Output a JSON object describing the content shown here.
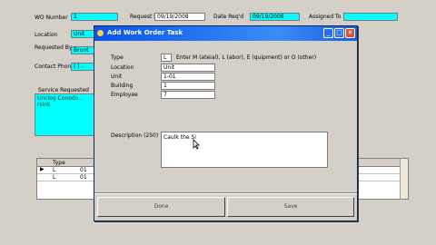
{
  "background_form": {
    "wo_number_label": "WO Number",
    "wo_number_value": "1",
    "request_date_label": "Request Date",
    "request_date_value": "09/19/2008",
    "date_reqd_label": "Date Req'd",
    "date_reqd_value": "09/19/2008",
    "assigned_to_label": "Assigned To",
    "assigned_to_value": "",
    "location_label": "Location",
    "location_value": "Unit",
    "requested_by_label": "Requested By",
    "requested_by_value": "Brunt",
    "contact_phone_label": "Contact Phone",
    "contact_phone_value": "( ) -",
    "service_requested_label": "Service Requested",
    "service_requested_value": "Unclog Conodo... rsink",
    "grid_headers": [
      "Type"
    ],
    "grid_rows": [
      {
        "marker": "▶",
        "type": "L",
        "value": "01"
      },
      {
        "marker": "",
        "type": "L",
        "value": "01"
      }
    ]
  },
  "dialog": {
    "title": "Add Work Order Task",
    "minimize_glyph": "_",
    "maximize_glyph": "□",
    "close_glyph": "✕",
    "type_label": "Type",
    "type_value": "L",
    "type_hint": "Enter M (ateial), L (abor), E (quipment) or O (other)",
    "location_label": "Location",
    "location_value": "Unit",
    "unit_label": "Unit",
    "unit_value": "1-01",
    "building_label": "Building",
    "building_value": "1",
    "employee_label": "Employee",
    "employee_value": "7",
    "description_label": "Description (250)",
    "description_value": "Caulk the Si",
    "buttons": {
      "done": "Done",
      "save": "Save"
    }
  },
  "colors": {
    "field_highlight": "#00ffff",
    "titlebar": "#0a54e8",
    "window_bg": "#d4d0c8"
  }
}
